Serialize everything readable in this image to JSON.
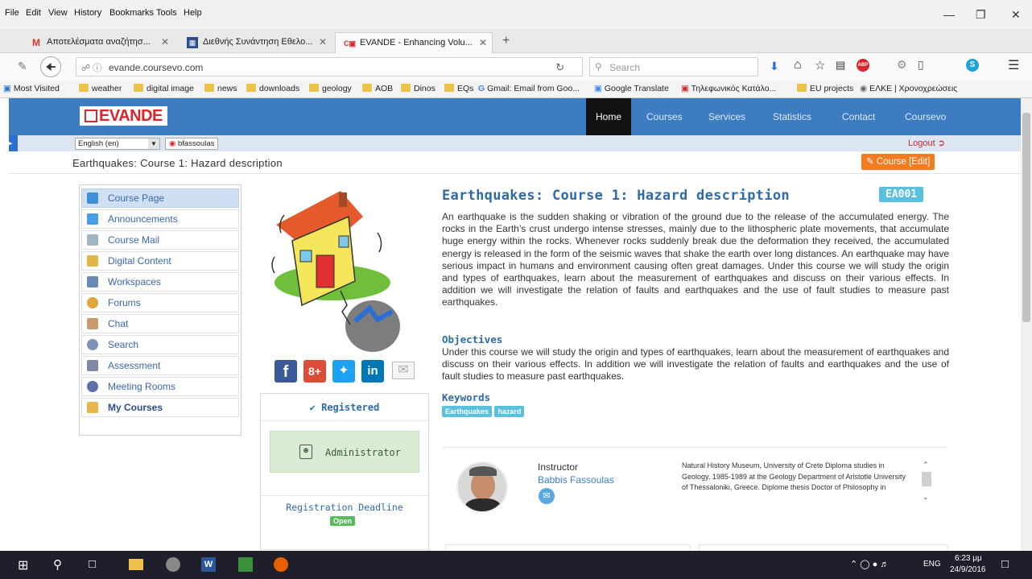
{
  "browser": {
    "menu": [
      "File",
      "Edit",
      "View",
      "History",
      "Bookmarks",
      "Tools",
      "Help"
    ],
    "tabs": [
      {
        "label": "Αποτελέσματα αναζήτησ...",
        "icon": "gmail-icon"
      },
      {
        "label": "Διεθνής Συνάντηση Εθελο...",
        "icon": "grid-icon"
      },
      {
        "label": "EVANDE - Enhancing Volu...",
        "icon": "evande-icon"
      }
    ],
    "url": "evande.coursevo.com",
    "search_placeholder": "Search",
    "bookmarks": [
      "Most Visited",
      "weather",
      "digital image",
      "news",
      "downloads",
      "geology",
      "AOB",
      "Dinos",
      "EQs",
      "Gmail: Email from Goo...",
      "Google Translate",
      "Τηλεφωνικός Κατάλο...",
      "EU projects",
      "ΕΛΚΕ | Χρονοχρεώσεις"
    ]
  },
  "site": {
    "logo": "EVANDE",
    "nav": [
      "Home",
      "Courses",
      "Services",
      "Statistics",
      "Contact",
      "Coursevo"
    ],
    "language": "English (en)",
    "user": "bfassoulas",
    "logout": "Logout",
    "breadcrumb": "Earthquakes: Course 1: Hazard description",
    "course_edit_btn": "Course [Edit]"
  },
  "sidebar": {
    "items": [
      {
        "label": "Course Page",
        "color": "#3f8fd6"
      },
      {
        "label": "Announcements",
        "color": "#4a9de0"
      },
      {
        "label": "Course Mail",
        "color": "#9fb6c9"
      },
      {
        "label": "Digital Content",
        "color": "#e4b64a"
      },
      {
        "label": "Workspaces",
        "color": "#6e88b6"
      },
      {
        "label": "Forums",
        "color": "#e0a53c"
      },
      {
        "label": "Chat",
        "color": "#c79b6a"
      },
      {
        "label": "Search",
        "color": "#7b93b8"
      },
      {
        "label": "Assessment",
        "color": "#7e8aa5"
      },
      {
        "label": "Meeting Rooms",
        "color": "#5b6fa8"
      },
      {
        "label": "My Courses",
        "color": "#e8b64a"
      }
    ]
  },
  "course": {
    "title": "Earthquakes: Course 1: Hazard description",
    "code": "EA001",
    "description": "An earthquake is the sudden shaking or vibration of the ground due to the release of the accumulated energy. The rocks in the Earth’s crust undergo intense stresses, mainly due to the lithospheric plate movements, that accumulate huge energy within the rocks. Whenever rocks suddenly break due the deformation they received, the accumulated energy is released in the form of the seismic waves that shake the earth over long distances. An earthquake may have serious impact in humans and environment causing often great damages. Under this course we will study the origin and types of earthquakes, learn about the measurement of earthquakes and discuss on their various effects. In addition we will investigate the relation of faults and earthquakes and the use of fault studies to measure past earthquakes.",
    "objectives_title": "Objectives",
    "objectives": "Under this course we will study the origin and types of earthquakes, learn about the measurement of earthquakes and discuss on their various effects. In addition we will investigate the relation of faults and earthquakes and the use of fault studies to measure past earthquakes.",
    "keywords_title": "Keywords",
    "keywords": [
      "Earthquakes",
      "hazard"
    ],
    "registered": "Registered",
    "role": "Administrator",
    "deadline_label": "Registration Deadline",
    "deadline_status": "Open",
    "instructor_label": "Instructor",
    "instructor_name": "Babbis Fassoulas",
    "instructor_bio": "Natural History Museum, University of Crete Diploma studies in Geology, 1985-1989 at the Geology Department of Aristotle University of Thessaloniki, Greece. Diplome thesis Doctor of Philosophy in"
  },
  "taskbar": {
    "lang": "ENG",
    "time": "6:23 μμ",
    "date": "24/9/2016"
  },
  "colors": {
    "header": "#3d7cc1",
    "link": "#2d6ba8",
    "badge": "#5bc0de",
    "edit_btn": "#f47b20"
  }
}
